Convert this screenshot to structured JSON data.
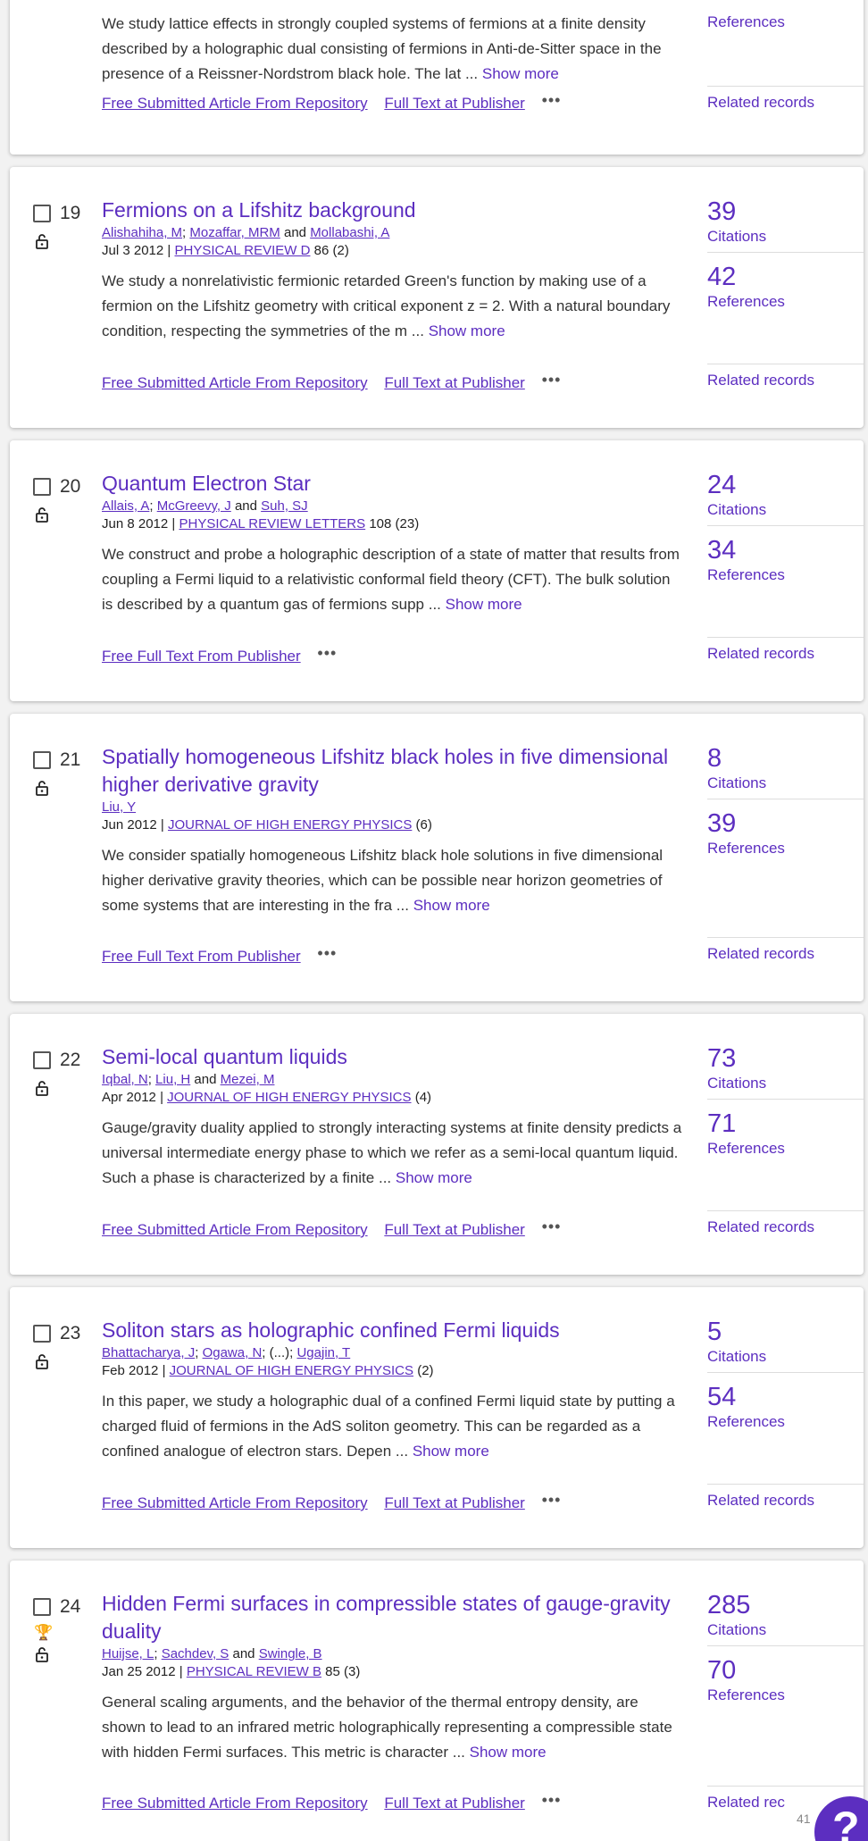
{
  "records": [
    {
      "number": "",
      "abstract": "We study lattice effects in strongly coupled systems of fermions at a finite density described by a holographic dual consisting of fermions in Anti-de-Sitter space in the presence of a Reissner-Nordstrom black hole. The lat",
      "links": [
        "Free Submitted Article From Repository",
        "Full Text at Publisher"
      ],
      "references": "References",
      "related": "Related records"
    },
    {
      "number": "19",
      "title": "Fermions on a Lifshitz background",
      "authors": [
        "Alishahiha, M",
        "Mozaffar, MRM",
        "Mollabashi, A"
      ],
      "date": "Jul 3 2012",
      "journal": "PHYSICAL REVIEW D",
      "volume": "86 (2)",
      "abstract": "We study a nonrelativistic fermionic retarded Green's function by making use of a fermion on the Lifshitz geometry with critical exponent z = 2. With a natural boundary condition, respecting the symmetries of the m",
      "links": [
        "Free Submitted Article From Repository",
        "Full Text at Publisher"
      ],
      "citations": "39",
      "references": "42"
    },
    {
      "number": "20",
      "title": "Quantum Electron Star",
      "authors": [
        "Allais, A",
        "McGreevy, J",
        "Suh, SJ"
      ],
      "date": "Jun 8 2012",
      "journal": "PHYSICAL REVIEW LETTERS",
      "volume": "108 (23)",
      "abstract": "We construct and probe a holographic description of a state of matter that results from coupling a Fermi liquid to a relativistic conformal field theory (CFT). The bulk solution is described by a quantum gas of fermions supp",
      "links": [
        "Free Full Text From Publisher"
      ],
      "citations": "24",
      "references": "34"
    },
    {
      "number": "21",
      "title": "Spatially homogeneous Lifshitz black holes in five dimensional higher derivative gravity",
      "authors": [
        "Liu, Y"
      ],
      "date": "Jun 2012",
      "journal": "JOURNAL OF HIGH ENERGY PHYSICS",
      "volume": "(6)",
      "abstract": "We consider spatially homogeneous Lifshitz black hole solutions in five dimensional higher derivative gravity theories, which can be possible near horizon geometries of some systems that are interesting in the fra",
      "links": [
        "Free Full Text From Publisher"
      ],
      "citations": "8",
      "references": "39"
    },
    {
      "number": "22",
      "title": "Semi-local quantum liquids",
      "authors": [
        "Iqbal, N",
        "Liu, H",
        "Mezei, M"
      ],
      "date": "Apr 2012",
      "journal": "JOURNAL OF HIGH ENERGY PHYSICS",
      "volume": "(4)",
      "abstract": "Gauge/gravity duality applied to strongly interacting systems at finite density predicts a universal intermediate energy phase to which we refer as a semi-local quantum liquid. Such a phase is characterized by a finite",
      "links": [
        "Free Submitted Article From Repository",
        "Full Text at Publisher"
      ],
      "citations": "73",
      "references": "71"
    },
    {
      "number": "23",
      "title": "Soliton stars as holographic confined Fermi liquids",
      "authors": [
        "Bhattacharya, J",
        "Ogawa, N",
        "Ugajin, T"
      ],
      "date": "Feb 2012",
      "journal": "JOURNAL OF HIGH ENERGY PHYSICS",
      "volume": "(2)",
      "abstract": "In this paper, we study a holographic dual of a confined Fermi liquid state by putting a charged fluid of fermions in the AdS soliton geometry. This can be regarded as a confined analogue of electron stars. Depen",
      "links": [
        "Free Submitted Article From Repository",
        "Full Text at Publisher"
      ],
      "citations": "5",
      "references": "54"
    },
    {
      "number": "24",
      "title": "Hidden Fermi surfaces in compressible states of gauge-gravity duality",
      "authors": [
        "Huijse, L",
        "Sachdev, S",
        "Swingle, B"
      ],
      "date": "Jan 25 2012",
      "journal": "PHYSICAL REVIEW B",
      "volume": "85 (3)",
      "abstract": "General scaling arguments, and the behavior of the thermal entropy density, are shown to lead to an infrared metric holographically representing a compressible state with hidden Fermi surfaces. This metric is character",
      "links": [
        "Free Submitted Article From Repository",
        "Full Text at Publisher"
      ],
      "citations": "285",
      "references": "70",
      "related": "Related rec"
    }
  ],
  "labels": {
    "citations": "Citations",
    "references": "References",
    "related": "Related records",
    "show_more": "Show more",
    "and": "and",
    "sep": ";",
    "ellipsis": "(...)",
    "pipe": "|",
    "dots": "•••",
    "trunc": "..."
  },
  "footer": {
    "page_number": "41",
    "help_label": "?"
  },
  "icons": {
    "lock": "lock-icon",
    "trophy": "trophy-icon",
    "more": "more-options-icon"
  },
  "colors": {
    "accent": "#5c2ec0",
    "trophy": "#e39a00"
  }
}
